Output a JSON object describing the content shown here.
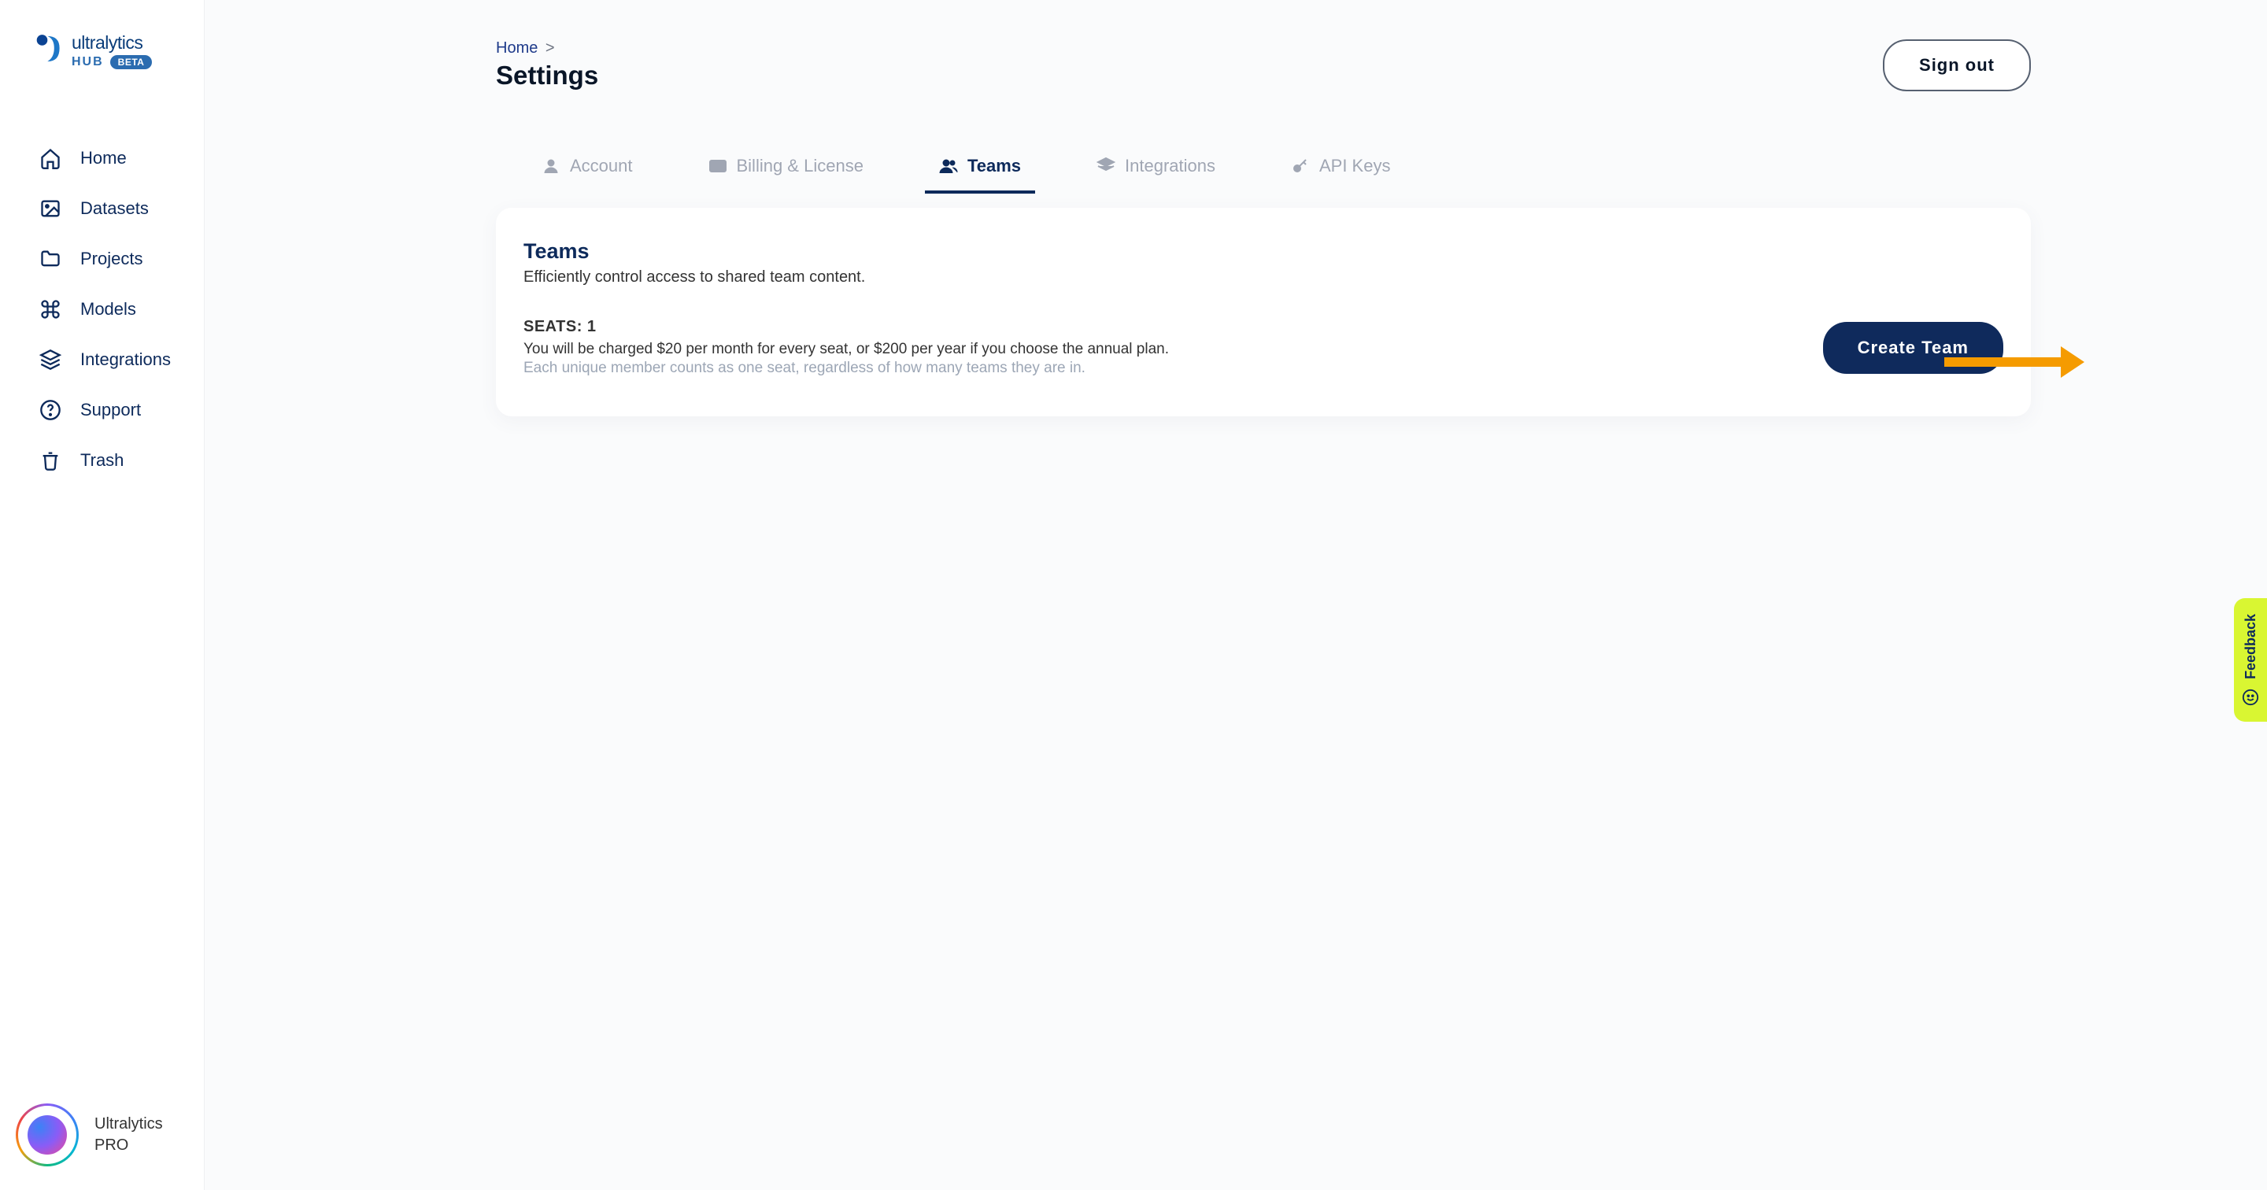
{
  "brand": {
    "name": "ultralytics",
    "hub": "HUB",
    "beta": "BETA"
  },
  "sidebar": {
    "items": [
      {
        "label": "Home",
        "icon": "home"
      },
      {
        "label": "Datasets",
        "icon": "image"
      },
      {
        "label": "Projects",
        "icon": "folder"
      },
      {
        "label": "Models",
        "icon": "command"
      },
      {
        "label": "Integrations",
        "icon": "layers"
      },
      {
        "label": "Support",
        "icon": "help"
      },
      {
        "label": "Trash",
        "icon": "trash"
      }
    ]
  },
  "user": {
    "name": "Ultralytics",
    "plan": "PRO"
  },
  "breadcrumb": {
    "home": "Home",
    "sep": ">"
  },
  "page_title": "Settings",
  "signout_label": "Sign out",
  "tabs": [
    {
      "label": "Account"
    },
    {
      "label": "Billing & License"
    },
    {
      "label": "Teams"
    },
    {
      "label": "Integrations"
    },
    {
      "label": "API Keys"
    }
  ],
  "teams_card": {
    "title": "Teams",
    "description": "Efficiently control access to shared team content.",
    "seats_label": "SEATS: 1",
    "charge_line": "You will be charged $20 per month for every seat, or $200 per year if you choose the annual plan.",
    "note_line": "Each unique member counts as one seat, regardless of how many teams they are in.",
    "create_button": "Create Team"
  },
  "feedback": {
    "label": "Feedback"
  }
}
